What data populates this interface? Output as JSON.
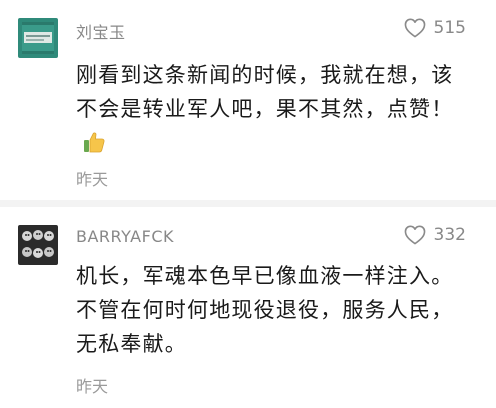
{
  "comments": [
    {
      "username": "刘宝玉",
      "likes": "515",
      "content": "刚看到这条新闻的时候，我就在想，该不会是转业军人吧，果不其然，点赞！",
      "emoji": "thumbs-up",
      "time": "昨天"
    },
    {
      "username": "BARRYAFCK",
      "likes": "332",
      "content": "机长，军魂本色早已像血液一样注入。不管在何时何地现役退役，服务人民，无私奉献。",
      "time": "昨天"
    }
  ],
  "colors": {
    "text": "#1a1a1a",
    "meta": "#888888",
    "divider": "#f3f3f3",
    "avatar1": "#2f8a7a"
  },
  "icons": {
    "like": "heart-outline-icon",
    "emoji": "thumbs-up-icon"
  }
}
